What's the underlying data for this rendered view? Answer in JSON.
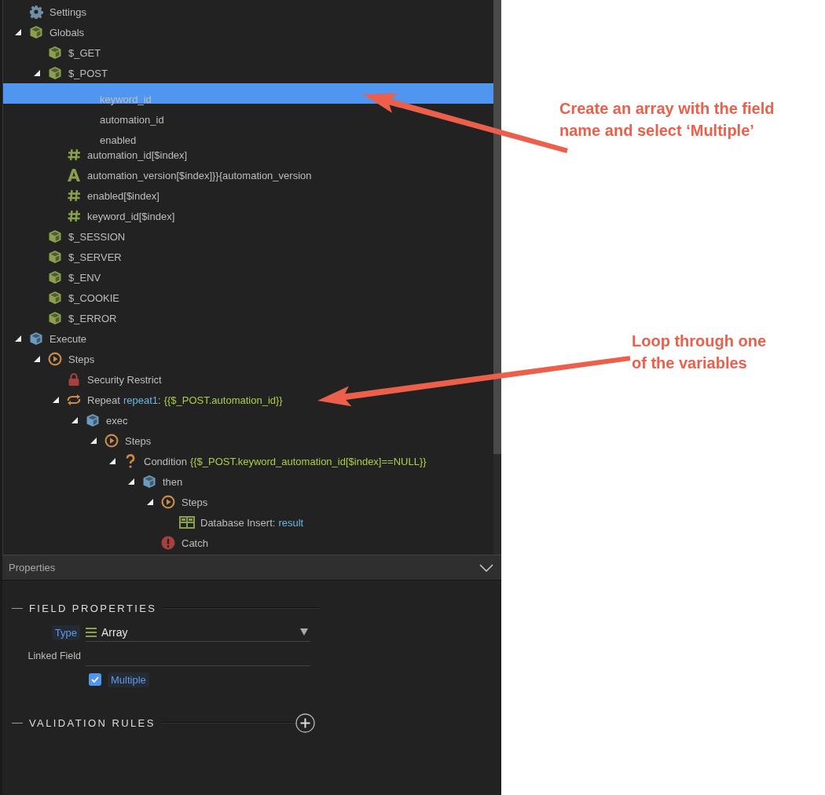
{
  "tree": {
    "items": [
      {
        "kind": "settings",
        "parts": [
          {
            "text": "Settings",
            "kind": "plain"
          }
        ],
        "selected": false
      },
      {
        "kind": "globals",
        "parts": [
          {
            "text": "Globals",
            "kind": "plain"
          }
        ],
        "selected": false,
        "expanded": true,
        "children": [
          {
            "kind": "globals",
            "parts": [
              {
                "text": "$_GET",
                "kind": "plain"
              }
            ],
            "selected": false
          },
          {
            "kind": "globals",
            "parts": [
              {
                "text": "$_POST",
                "kind": "plain"
              }
            ],
            "selected": false,
            "expanded": true,
            "children": [
              {
                "kind": "field",
                "parts": [
                  {
                    "text": "keyword_id",
                    "kind": "plain"
                  }
                ],
                "selected": true
              },
              {
                "kind": "field",
                "parts": [
                  {
                    "text": "automation_id",
                    "kind": "plain"
                  }
                ],
                "selected": false
              },
              {
                "kind": "field",
                "parts": [
                  {
                    "text": "enabled",
                    "kind": "plain"
                  }
                ],
                "selected": false
              },
              {
                "kind": "number",
                "parts": [
                  {
                    "text": "automation_id[$index]",
                    "kind": "plain"
                  }
                ],
                "selected": false
              },
              {
                "kind": "text",
                "parts": [
                  {
                    "text": "automation_version[$index]}}{automation_version",
                    "kind": "plain"
                  }
                ],
                "selected": false
              },
              {
                "kind": "number",
                "parts": [
                  {
                    "text": "enabled[$index]",
                    "kind": "plain"
                  }
                ],
                "selected": false
              },
              {
                "kind": "number",
                "parts": [
                  {
                    "text": "keyword_id[$index]",
                    "kind": "plain"
                  }
                ],
                "selected": false
              }
            ]
          },
          {
            "kind": "globals",
            "parts": [
              {
                "text": "$_SESSION",
                "kind": "plain"
              }
            ],
            "selected": false
          },
          {
            "kind": "globals",
            "parts": [
              {
                "text": "$_SERVER",
                "kind": "plain"
              }
            ],
            "selected": false
          },
          {
            "kind": "globals",
            "parts": [
              {
                "text": "$_ENV",
                "kind": "plain"
              }
            ],
            "selected": false
          },
          {
            "kind": "globals",
            "parts": [
              {
                "text": "$_COOKIE",
                "kind": "plain"
              }
            ],
            "selected": false
          },
          {
            "kind": "globals",
            "parts": [
              {
                "text": "$_ERROR",
                "kind": "plain"
              }
            ],
            "selected": false
          }
        ]
      },
      {
        "kind": "execute",
        "parts": [
          {
            "text": "Execute",
            "kind": "plain"
          }
        ],
        "selected": false,
        "expanded": true,
        "children": [
          {
            "kind": "steps",
            "parts": [
              {
                "text": "Steps",
                "kind": "plain"
              }
            ],
            "selected": false,
            "expanded": true,
            "children": [
              {
                "kind": "lock",
                "parts": [
                  {
                    "text": "Security Restrict",
                    "kind": "plain"
                  }
                ],
                "selected": false
              },
              {
                "kind": "repeat",
                "parts": [
                  {
                    "text": "Repeat",
                    "kind": "plain"
                  },
                  {
                    "text": "repeat1",
                    "kind": "name"
                  },
                  {
                    "text": ":",
                    "kind": "plain"
                  },
                  {
                    "text": "{{$_POST.automation_id}}",
                    "kind": "expr"
                  }
                ],
                "selected": false,
                "expanded": true,
                "children": [
                  {
                    "kind": "execute",
                    "parts": [
                      {
                        "text": "exec",
                        "kind": "plain"
                      }
                    ],
                    "selected": false,
                    "expanded": true,
                    "children": [
                      {
                        "kind": "steps",
                        "parts": [
                          {
                            "text": "Steps",
                            "kind": "plain"
                          }
                        ],
                        "selected": false,
                        "expanded": true,
                        "children": [
                          {
                            "kind": "condition",
                            "parts": [
                              {
                                "text": "Condition",
                                "kind": "plain"
                              },
                              {
                                "text": "{{$_POST.keyword_automation_id[$index]==NULL}}",
                                "kind": "expr"
                              }
                            ],
                            "selected": false,
                            "expanded": true,
                            "children": [
                              {
                                "kind": "execute",
                                "parts": [
                                  {
                                    "text": "then",
                                    "kind": "plain"
                                  }
                                ],
                                "selected": false,
                                "expanded": true,
                                "children": [
                                  {
                                    "kind": "steps",
                                    "parts": [
                                      {
                                        "text": "Steps",
                                        "kind": "plain"
                                      }
                                    ],
                                    "selected": false,
                                    "expanded": true,
                                    "children": [
                                      {
                                        "kind": "table",
                                        "parts": [
                                          {
                                            "text": "Database Insert:",
                                            "kind": "plain"
                                          },
                                          {
                                            "text": "result",
                                            "kind": "name"
                                          }
                                        ],
                                        "selected": false
                                      }
                                    ]
                                  },
                                  {
                                    "kind": "catch",
                                    "parts": [
                                      {
                                        "text": "Catch",
                                        "kind": "plain"
                                      }
                                    ],
                                    "selected": false
                                  }
                                ]
                              }
                            ]
                          }
                        ]
                      }
                    ]
                  }
                ]
              }
            ]
          }
        ]
      }
    ]
  },
  "properties": {
    "title": "Properties",
    "field_section": {
      "title": "FIELD PROPERTIES",
      "type_label": "Type",
      "type_value": "Array",
      "linked_field_label": "Linked Field",
      "multiple": {
        "label": "Multiple",
        "checked": true
      }
    },
    "validation_section": {
      "title": "VALIDATION RULES"
    }
  },
  "annotations": [
    {
      "lines": [
        "Create an array with the field",
        "name and select ‘Multiple’"
      ]
    },
    {
      "lines": [
        "Loop through one",
        "of the variables"
      ]
    }
  ]
}
